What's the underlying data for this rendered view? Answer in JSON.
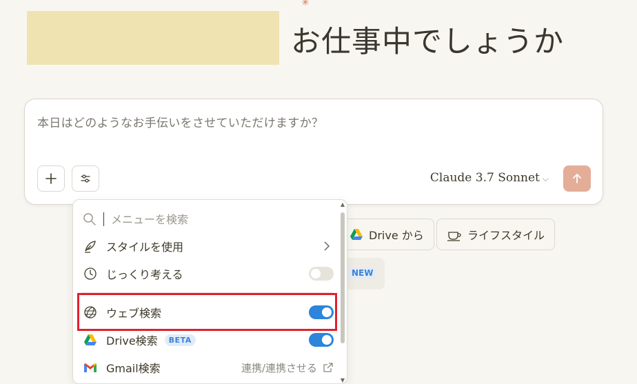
{
  "header": {
    "greeting": "お仕事中でしょうか"
  },
  "composer": {
    "placeholder": "本日はどのようなお手伝いをさせていただけますか？",
    "model_label": "Claude 3.7 Sonnet",
    "icons": {
      "add": "plus-icon",
      "tools": "sliders-icon",
      "send": "arrow-up-icon",
      "model": "chevron-down-icon"
    }
  },
  "chips": [
    {
      "label": "Drive から",
      "icon": "google-drive-icon"
    },
    {
      "label": "ライフスタイル",
      "icon": "coffee-cup-icon"
    }
  ],
  "chip_new_badge": "NEW",
  "menu": {
    "search_placeholder": "メニューを検索",
    "items": [
      {
        "label": "スタイルを使用",
        "icon": "feather-pen-icon",
        "control": "chevron-right"
      },
      {
        "label": "じっくり考える",
        "icon": "clock-icon",
        "control": "toggle",
        "enabled": false
      },
      {
        "label": "ウェブ検索",
        "icon": "globe-icon",
        "control": "toggle",
        "enabled": true
      },
      {
        "label": "Drive検索",
        "icon": "google-drive-icon",
        "badge": "BETA",
        "control": "toggle",
        "enabled": true
      },
      {
        "label": "Gmail検索",
        "icon": "gmail-icon",
        "control": "link",
        "link_text": "連携/連携させる"
      }
    ]
  },
  "colors": {
    "background": "#f8f6f1",
    "accent_send": "#e3ad98",
    "toggle_on": "#2c84db",
    "highlight": "#e0202e"
  }
}
